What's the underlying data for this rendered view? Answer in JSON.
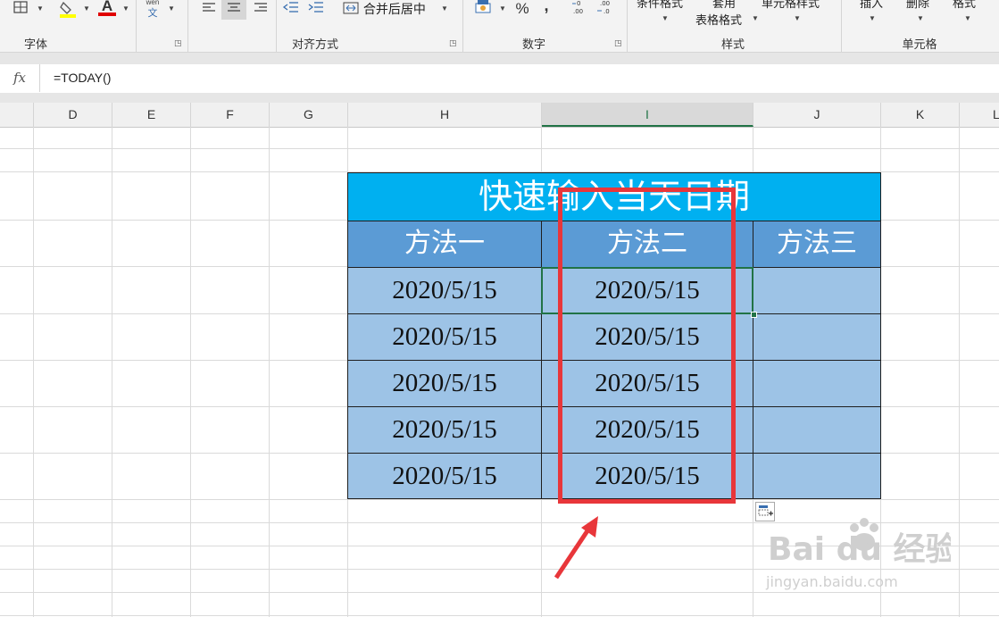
{
  "ribbon": {
    "groups": [
      {
        "label": "字体"
      },
      {
        "label": "对齐方式"
      },
      {
        "label": "数字"
      },
      {
        "label": "样式"
      },
      {
        "label": "单元格"
      }
    ],
    "merge_center_label": "合并后居中",
    "wen_label": "wén",
    "wen_char": "文",
    "percent_label": "%",
    "comma_label": ",",
    "styles": {
      "conditional_format": "条件格式",
      "table_format_top": "套用",
      "table_format": "表格格式",
      "cell_styles": "单元格样式"
    },
    "cells": {
      "insert": "插入",
      "delete": "删除",
      "format": "格式"
    }
  },
  "formula_bar": {
    "fx_label": "fx",
    "formula": "=TODAY()"
  },
  "columns": [
    "D",
    "E",
    "F",
    "G",
    "H",
    "I",
    "J",
    "K",
    "L"
  ],
  "selected_column": "I",
  "table": {
    "title": "快速输入当天日期",
    "headers": [
      "方法一",
      "方法二",
      "方法三"
    ],
    "rows": [
      [
        "2020/5/15",
        "2020/5/15",
        ""
      ],
      [
        "2020/5/15",
        "2020/5/15",
        ""
      ],
      [
        "2020/5/15",
        "2020/5/15",
        ""
      ],
      [
        "2020/5/15",
        "2020/5/15",
        ""
      ],
      [
        "2020/5/15",
        "2020/5/15",
        ""
      ]
    ]
  },
  "colors": {
    "title_bg": "#00b0f0",
    "header_bg": "#5b9bd5",
    "data_bg": "#9dc3e6",
    "highlight": "#e8363a",
    "selection": "#217346"
  },
  "watermark": {
    "brand": "Bai du 经验",
    "url": "jingyan.baidu.com"
  }
}
